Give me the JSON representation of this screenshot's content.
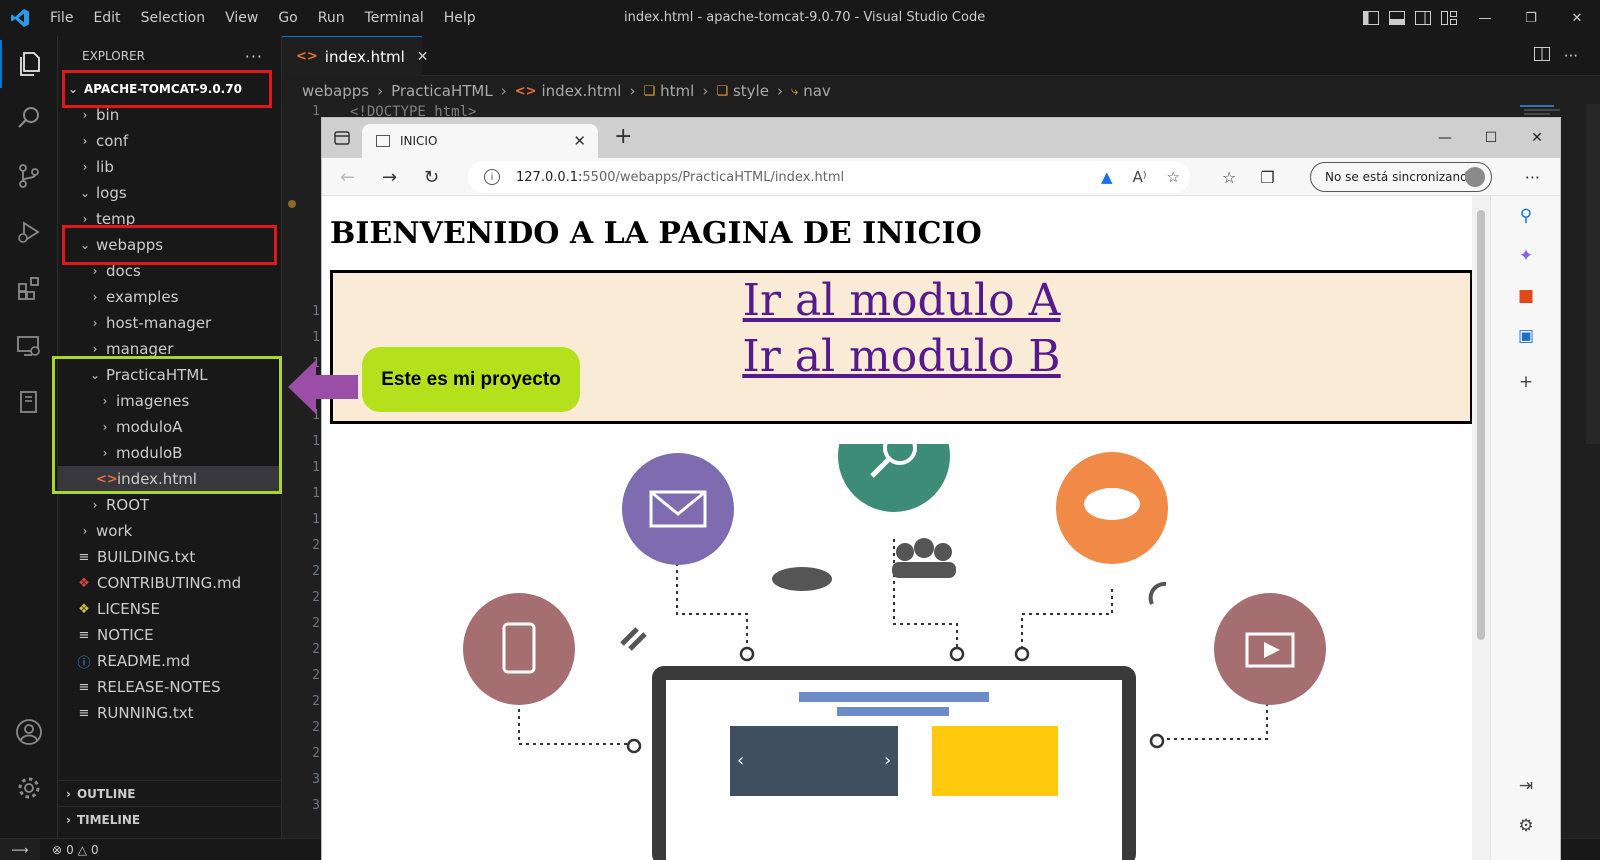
{
  "menu": [
    "File",
    "Edit",
    "Selection",
    "View",
    "Go",
    "Run",
    "Terminal",
    "Help"
  ],
  "window_title": "index.html - apache-tomcat-9.0.70 - Visual Studio Code",
  "explorer": {
    "title": "EXPLORER",
    "root": "APACHE-TOMCAT-9.0.70",
    "items": [
      {
        "label": "bin"
      },
      {
        "label": "conf"
      },
      {
        "label": "lib"
      },
      {
        "label": "logs"
      },
      {
        "label": "temp"
      },
      {
        "label": "webapps"
      },
      {
        "label": "docs"
      },
      {
        "label": "examples"
      },
      {
        "label": "host-manager"
      },
      {
        "label": "manager"
      },
      {
        "label": "PracticaHTML"
      },
      {
        "label": "imagenes"
      },
      {
        "label": "moduloA"
      },
      {
        "label": "moduloB"
      },
      {
        "label": "index.html"
      },
      {
        "label": "ROOT"
      },
      {
        "label": "work"
      },
      {
        "label": "BUILDING.txt"
      },
      {
        "label": "CONTRIBUTING.md"
      },
      {
        "label": "LICENSE"
      },
      {
        "label": "NOTICE"
      },
      {
        "label": "README.md"
      },
      {
        "label": "RELEASE-NOTES"
      },
      {
        "label": "RUNNING.txt"
      }
    ],
    "sections": [
      "OUTLINE",
      "TIMELINE"
    ]
  },
  "editor": {
    "tab_label": "index.html",
    "breadcrumbs": [
      "webapps",
      "PracticaHTML",
      "index.html",
      "html",
      "style",
      "nav"
    ],
    "line1_number": "1",
    "line1_code": "<!DOCTYPE html>",
    "gutter_numbers": [
      "1",
      "1",
      "1",
      "1",
      "1",
      "1",
      "1",
      "1",
      "1",
      "2",
      "2",
      "2",
      "2",
      "2",
      "2",
      "2",
      "2",
      "2",
      "3",
      "3"
    ]
  },
  "status": {
    "errors": "0",
    "warnings": "0"
  },
  "browser": {
    "tab_title": "INICIO",
    "url_host": "127.0.0.1:",
    "url_rest": "5500/webapps/PracticaHTML/index.html",
    "sync_label": "No se está sincronizando"
  },
  "page": {
    "heading": "BIENVENIDO A LA PAGINA DE INICIO",
    "link_a": "Ir al modulo A",
    "link_b": "Ir al modulo B"
  },
  "callout": "Este es mi proyecto",
  "colors": {
    "accent": "#0078d4",
    "highlight_red": "#e0181b",
    "highlight_green": "#a8d62a",
    "callout_bg": "#b4e01c",
    "arrow": "#9b4ea6",
    "nav_bg": "#faebd7",
    "link": "#551a8b"
  }
}
